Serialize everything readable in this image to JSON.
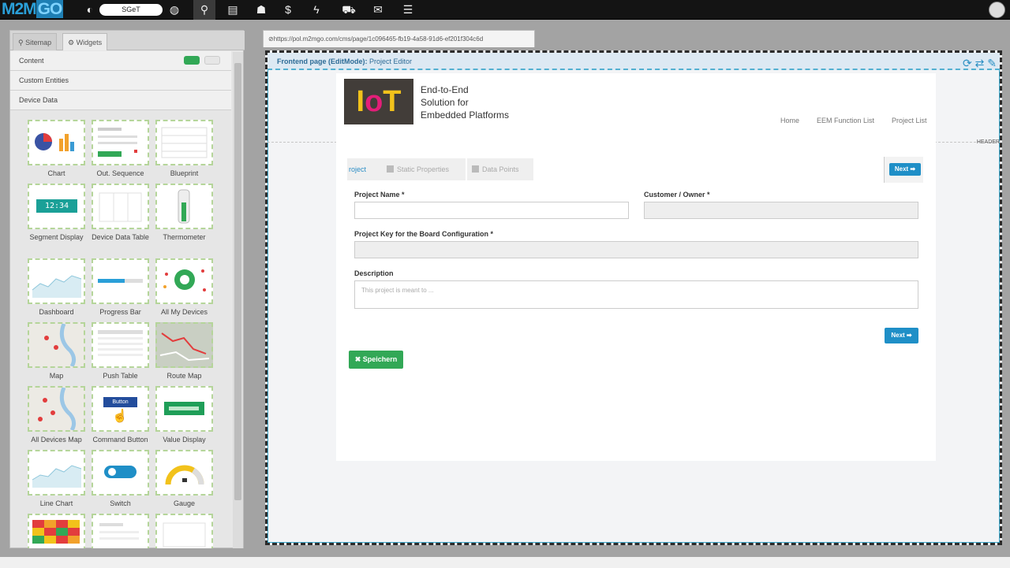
{
  "topbar": {
    "logo_left": "M2M",
    "logo_right": "GO",
    "tenant": "SGeT",
    "icons": [
      "tenant-icon",
      "globe-icon",
      "sitemap-icon",
      "list-icon",
      "user-icon",
      "dollar-icon",
      "bolt-icon",
      "cart-icon",
      "chat-icon",
      "tasks-icon"
    ]
  },
  "sidebar": {
    "tabs": [
      {
        "label": "Sitemap"
      },
      {
        "label": "Widgets"
      }
    ],
    "categories": [
      {
        "label": "Content"
      },
      {
        "label": "Custom Entities"
      },
      {
        "label": "Device Data"
      }
    ],
    "widgets": [
      {
        "label": "Chart"
      },
      {
        "label": "Out. Sequence"
      },
      {
        "label": "Blueprint"
      },
      {
        "label": "Segment Display"
      },
      {
        "label": "Device Data Table"
      },
      {
        "label": "Thermometer"
      },
      {
        "label": "Dashboard"
      },
      {
        "label": "Progress Bar"
      },
      {
        "label": "All My Devices"
      },
      {
        "label": "Map"
      },
      {
        "label": "Push Table"
      },
      {
        "label": "Route Map"
      },
      {
        "label": "All Devices Map"
      },
      {
        "label": "Command Button"
      },
      {
        "label": "Value Display"
      },
      {
        "label": "Line Chart"
      },
      {
        "label": "Switch"
      },
      {
        "label": "Gauge"
      }
    ],
    "segment_value": "12:34",
    "button_text": "Button"
  },
  "browser": {
    "url": "https://pol.m2mgo.com/cms/page/1c096465-fb19-4a58-91d6-ef201f304c6d"
  },
  "editor": {
    "mode_label": "Frontend page (EditMode):",
    "page_name": "Project Editor",
    "head_tag": "HEADER"
  },
  "site": {
    "logo_i": "I",
    "logo_o": "o",
    "logo_t": "T",
    "tagline": [
      "End-to-End",
      "Solution for",
      "Embedded Platforms"
    ],
    "nav": [
      {
        "label": "Home"
      },
      {
        "label": "EEM Function List"
      },
      {
        "label": "Project List"
      }
    ]
  },
  "wizard": {
    "steps": [
      {
        "label": "roject"
      },
      {
        "label": "Static Properties"
      },
      {
        "label": "Data Points"
      }
    ],
    "next_label": "Next ➡"
  },
  "form": {
    "project_name_label": "Project Name *",
    "customer_label": "Customer / Owner *",
    "project_key_label": "Project Key for the Board Configuration *",
    "description_label": "Description",
    "description_placeholder": "This project is meant to ...",
    "next_label": "Next ➡",
    "save_label": "✖ Speichern"
  },
  "colors": {
    "accent": "#1f8fc7",
    "save_green": "#32a856",
    "widget_border": "#b5d59a"
  }
}
